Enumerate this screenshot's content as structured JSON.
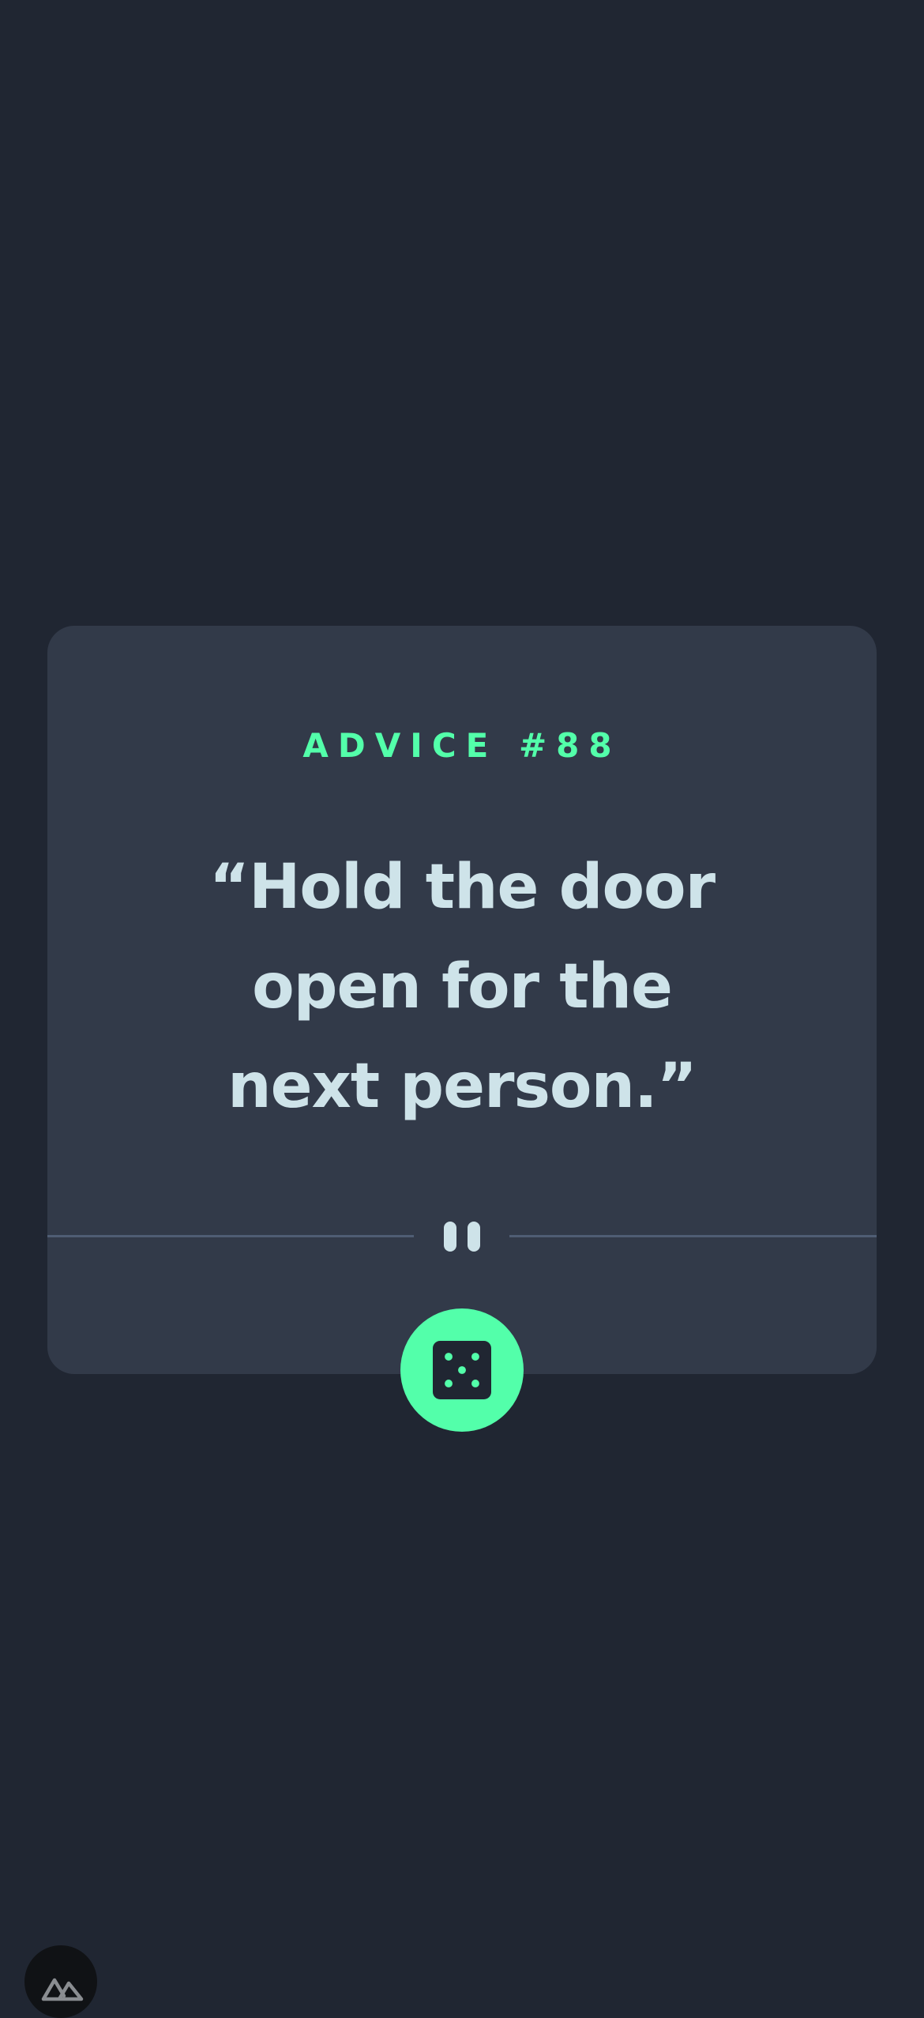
{
  "advice": {
    "label": "ADVICE #88",
    "quote": "“Hold the door open for the next person.”"
  },
  "icons": {
    "divider_center": "pause-icon",
    "generate_button": "dice-icon",
    "corner_badge": "nuxt-logo-icon"
  },
  "colors": {
    "background": "#202632",
    "card": "#323a49",
    "accent": "#53ffaa",
    "text": "#cee3e9",
    "divider": "#4f5d74"
  }
}
